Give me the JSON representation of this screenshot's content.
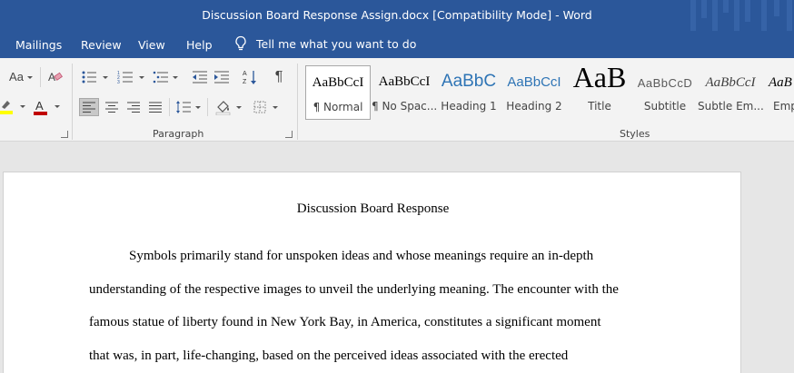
{
  "window": {
    "title": "Discussion Board Response Assign.docx [Compatibility Mode]  -  Word"
  },
  "tabs": [
    {
      "label": "Mailings"
    },
    {
      "label": "Review"
    },
    {
      "label": "View"
    },
    {
      "label": "Help"
    }
  ],
  "tell_me": {
    "label": "Tell me what you want to do"
  },
  "font_group": {
    "change_case_label": "Aa"
  },
  "groups": {
    "paragraph": "Paragraph",
    "styles": "Styles"
  },
  "styles": [
    {
      "sample": "AaBbCcI",
      "name": "¶ Normal"
    },
    {
      "sample": "AaBbCcI",
      "name": "¶ No Spac..."
    },
    {
      "sample": "AaBbC",
      "name": "Heading 1"
    },
    {
      "sample": "AaBbCcI",
      "name": "Heading 2"
    },
    {
      "sample": "AaB",
      "name": "Title"
    },
    {
      "sample": "AaBbCcD",
      "name": "Subtitle"
    },
    {
      "sample": "AaBbCcI",
      "name": "Subtle Em..."
    },
    {
      "sample": "AaB",
      "name": "Emp"
    }
  ],
  "document": {
    "title": "Discussion Board Response",
    "lines": [
      "Symbols primarily stand for unspoken ideas and whose meanings require an in-depth",
      "understanding of the respective images to unveil the underlying meaning. The encounter with the",
      "famous statue of liberty found in New York Bay, in America, constitutes a significant moment",
      "that was, in part, life-changing, based on the perceived ideas associated with the erected"
    ]
  },
  "colors": {
    "title_bar": "#2b579a",
    "ribbon": "#f3f3f3",
    "highlight": "#ffff00",
    "font_color": "#c00000",
    "heading_blue": "#2e74b5"
  }
}
